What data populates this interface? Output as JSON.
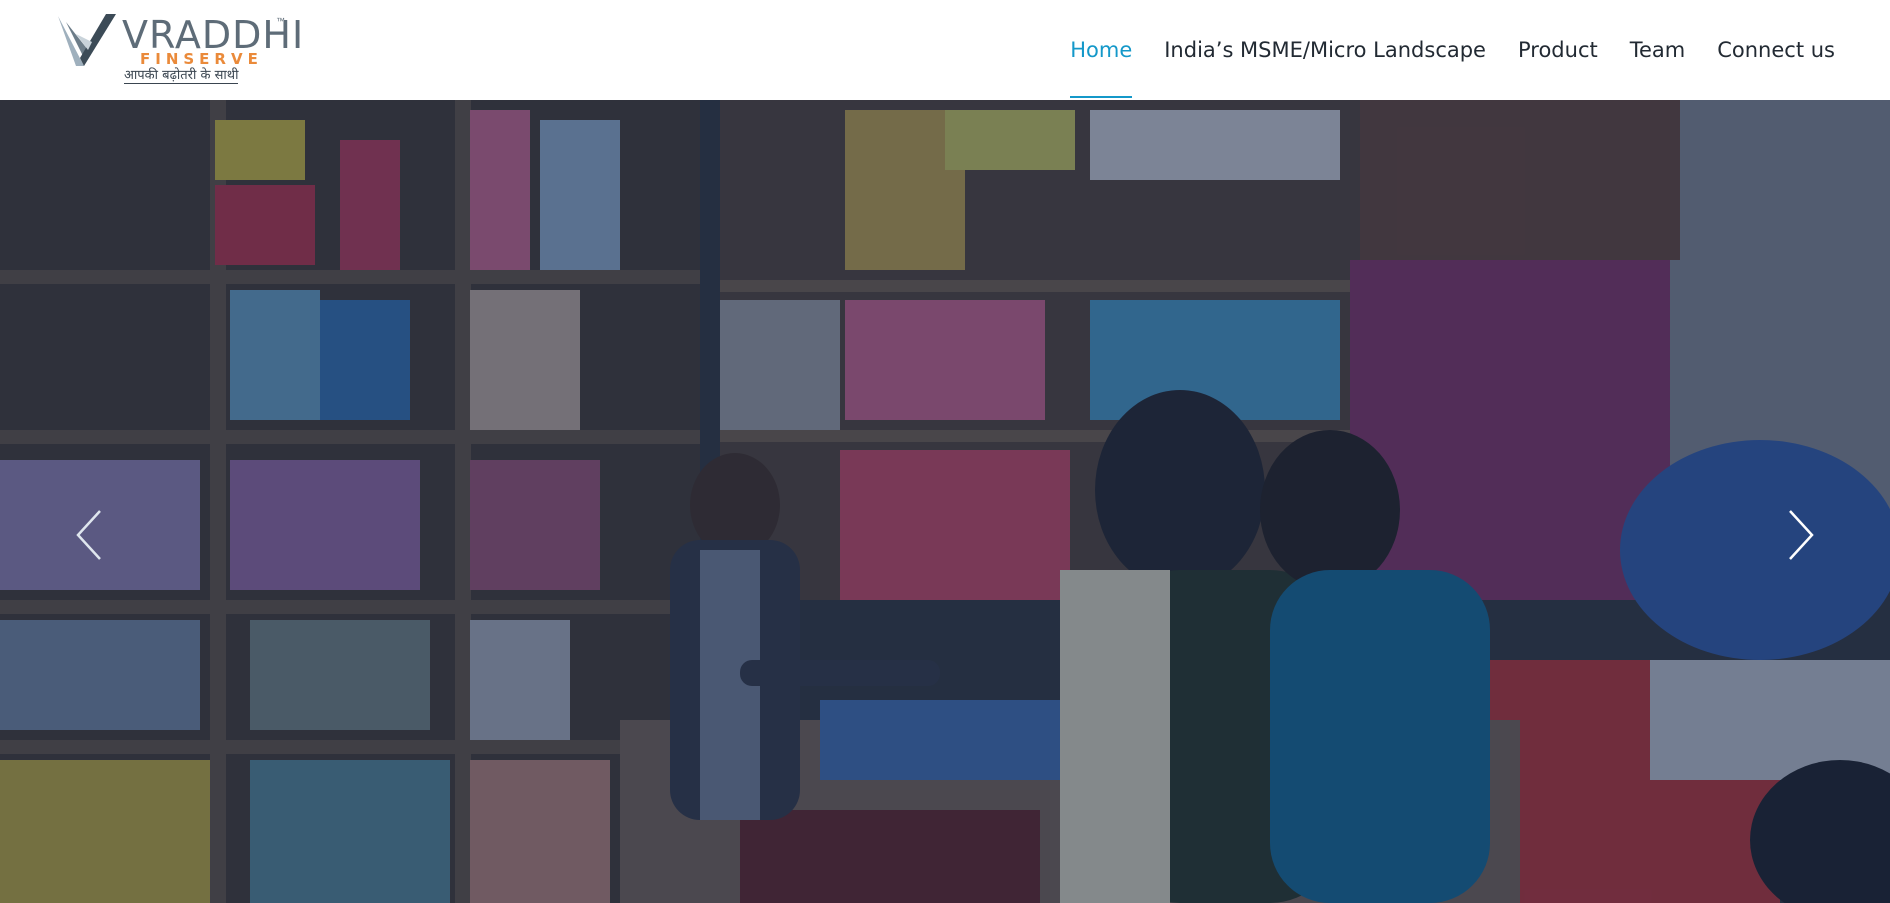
{
  "brand": {
    "name": "VRADDHI",
    "trademark": "™",
    "subname": "FINSERVE",
    "tagline": "आपकी  बढ़ोतरी के साथी",
    "colors": {
      "primary": "#5e6c78",
      "accent": "#ea8a3a",
      "mark_light": "#9fb0bd",
      "mark_dark": "#3c4b57"
    }
  },
  "nav": {
    "items": [
      {
        "label": "Home",
        "active": true
      },
      {
        "label": "India’s MSME/Micro Landscape",
        "active": false
      },
      {
        "label": "Product",
        "active": false
      },
      {
        "label": "Team",
        "active": false
      },
      {
        "label": "Connect us",
        "active": false
      }
    ],
    "active_color": "#1498c9"
  },
  "hero": {
    "image_subject": "shopkeeper serving customers in a textile shop",
    "prev_icon": "chevron-left-icon",
    "next_icon": "chevron-right-icon"
  }
}
